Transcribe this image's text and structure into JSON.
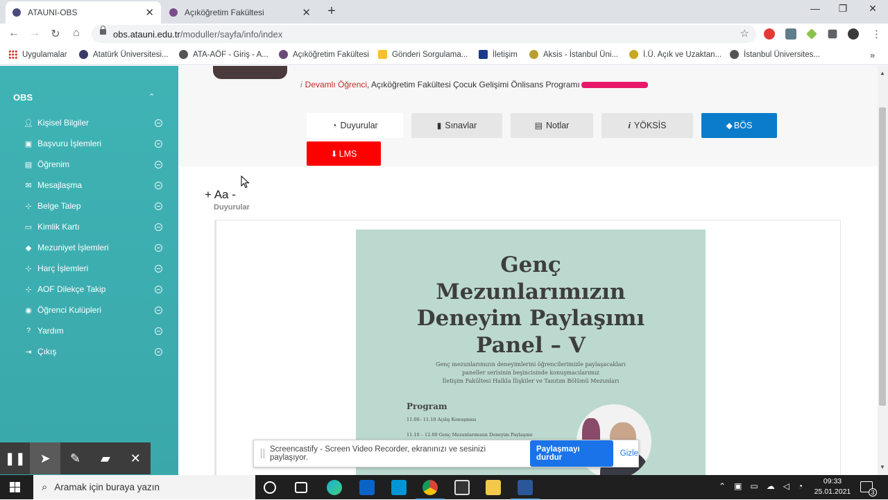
{
  "browser": {
    "tabs": [
      {
        "label": "ATAUNI-OBS",
        "active": true
      },
      {
        "label": "Açıköğretim Fakültesi",
        "active": false
      }
    ],
    "url_host": "obs.atauni.edu.tr",
    "url_path": "/moduller/sayfa/info/index"
  },
  "bookmarks": [
    "Uygulamalar",
    "Atatürk Üniversitesi...",
    "ATA-AÖF - Giriş - A...",
    "Açıköğretim Fakültesi",
    "Gönderi Sorgulama...",
    "İletişim",
    "Aksis - İstanbul Üni...",
    "İ.Ü. Açık ve Uzaktan...",
    "İstanbul Üniversites..."
  ],
  "sidebar": {
    "title": "OBS",
    "items": [
      {
        "label": "Kişisel Bilgiler",
        "icon": "user-icon"
      },
      {
        "label": "Başvuru İşlemleri",
        "icon": "briefcase-icon"
      },
      {
        "label": "Öğrenim",
        "icon": "book-icon"
      },
      {
        "label": "Mesajlaşma",
        "icon": "envelope-icon"
      },
      {
        "label": "Belge Talep",
        "icon": "sitemap-icon"
      },
      {
        "label": "Kimlik Kartı",
        "icon": "id-card-icon"
      },
      {
        "label": "Mezuniyet İşlemleri",
        "icon": "graduation-cap-icon"
      },
      {
        "label": "Harç İşlemleri",
        "icon": "sitemap-icon"
      },
      {
        "label": "AOF Dilekçe Takip",
        "icon": "sitemap-icon"
      },
      {
        "label": "Öğrenci Kulüpleri",
        "icon": "clubs-icon"
      },
      {
        "label": "Yardım",
        "icon": "help-icon"
      },
      {
        "label": "Çıkış",
        "icon": "sign-out-icon"
      }
    ]
  },
  "student": {
    "status": "Devamlı Öğrenci",
    "program": ", Açıköğretim Fakültesi Çocuk Gelişimi Önlisans Programı"
  },
  "nav_buttons": {
    "duyurular": "Duyurular",
    "sinavlar": "Sınavlar",
    "notlar": "Notlar",
    "yoksis": "YÖKSİS",
    "bos": "BÖS",
    "lms": "LMS"
  },
  "font_control": "+ Aa -",
  "section_label": "Duyurular",
  "poster": {
    "title_lines": [
      "Genç",
      "Mezunlarımızın",
      "Deneyim Paylaşımı",
      "Panel – V"
    ],
    "desc_lines": [
      "Genç mezunlarımızın deneyimlerini öğrencilerimizle paylaşacakları",
      "paneller serisinin beşincisinde konuşmacılarımız",
      "İletişim Fakültesi Halkla İlişkiler ve Tanıtım Bölümü Mezunları"
    ],
    "program_label": "Program",
    "program_rows": [
      "11.00– 11.10  Açılış Konuşması",
      "11.10 – 12.00   Genç Mezunlarımızın Deneyim Paylaşımı"
    ]
  },
  "screencastify": {
    "message": "Screencastify - Screen Video Recorder, ekranınızı ve sesinizi paylaşıyor.",
    "stop_label": "Paylaşmayı durdur",
    "hide_label": "Gizle"
  },
  "taskbar": {
    "search_placeholder": "Aramak için buraya yazın",
    "time": "09:33",
    "date": "25.01.2021",
    "notification_count": "3"
  },
  "colors": {
    "sidebar": "#3fb3b5",
    "bos_button": "#0a7cc9",
    "lms_button": "#ff0000",
    "status_text": "#c62828"
  }
}
